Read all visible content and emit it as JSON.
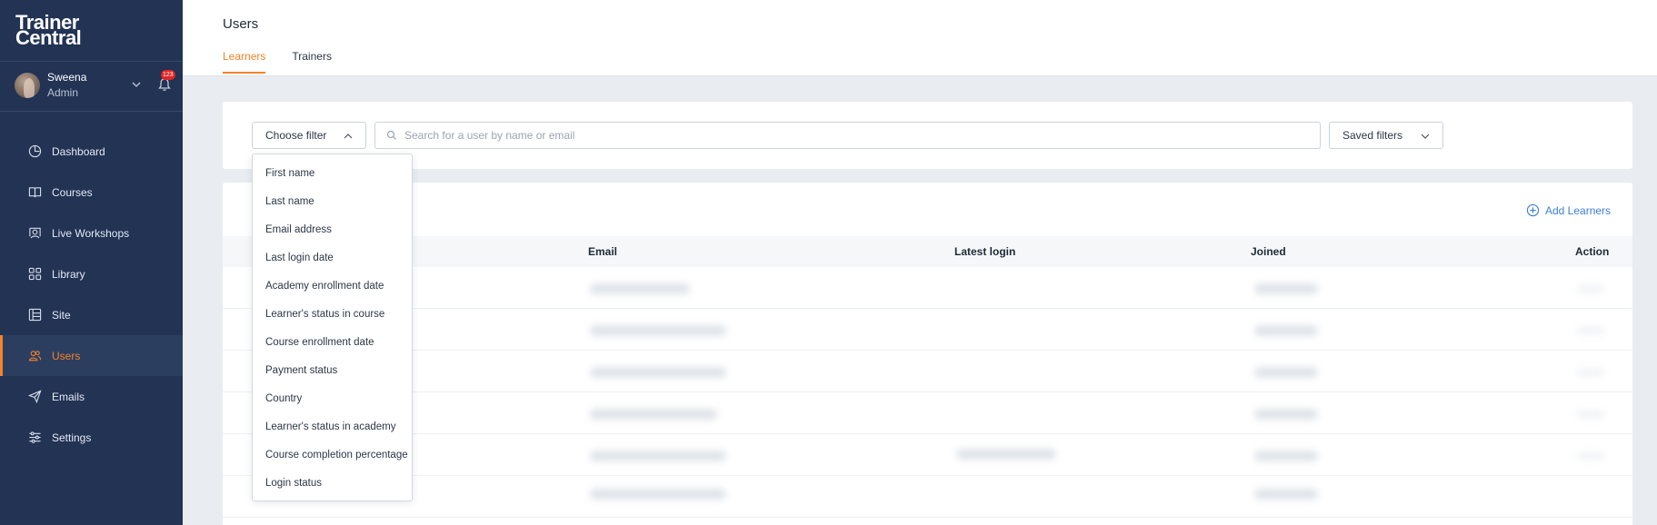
{
  "brand": {
    "line1": "Trainer",
    "line2": "Central"
  },
  "profile": {
    "name": "Sweena",
    "role": "Admin",
    "notifications": "123"
  },
  "nav": [
    {
      "label": "Dashboard",
      "icon": "dashboard-icon"
    },
    {
      "label": "Courses",
      "icon": "courses-icon"
    },
    {
      "label": "Live Workshops",
      "icon": "live-workshops-icon"
    },
    {
      "label": "Library",
      "icon": "library-icon"
    },
    {
      "label": "Site",
      "icon": "site-icon"
    },
    {
      "label": "Users",
      "icon": "users-icon",
      "active": true
    },
    {
      "label": "Emails",
      "icon": "emails-icon"
    },
    {
      "label": "Settings",
      "icon": "settings-icon"
    }
  ],
  "header": {
    "title": "Users",
    "tabs": [
      {
        "label": "Learners",
        "active": true
      },
      {
        "label": "Trainers"
      }
    ]
  },
  "filters": {
    "choose_label": "Choose filter",
    "search_placeholder": "Search for a user by name or email",
    "saved_label": "Saved filters",
    "options": [
      "First name",
      "Last name",
      "Email address",
      "Last login date",
      "Academy enrollment date",
      "Learner's status in course",
      "Course enrollment date",
      "Payment status",
      "Country",
      "Learner's status in academy",
      "Course completion percentage",
      "Login status"
    ]
  },
  "table": {
    "add_label": "Add Learners",
    "columns": [
      "Email",
      "Latest login",
      "Joined",
      "Action"
    ]
  },
  "colors": {
    "accent": "#f5822a",
    "sidebar": "#223354",
    "link": "#3e7fd3",
    "badge": "#e02424"
  }
}
